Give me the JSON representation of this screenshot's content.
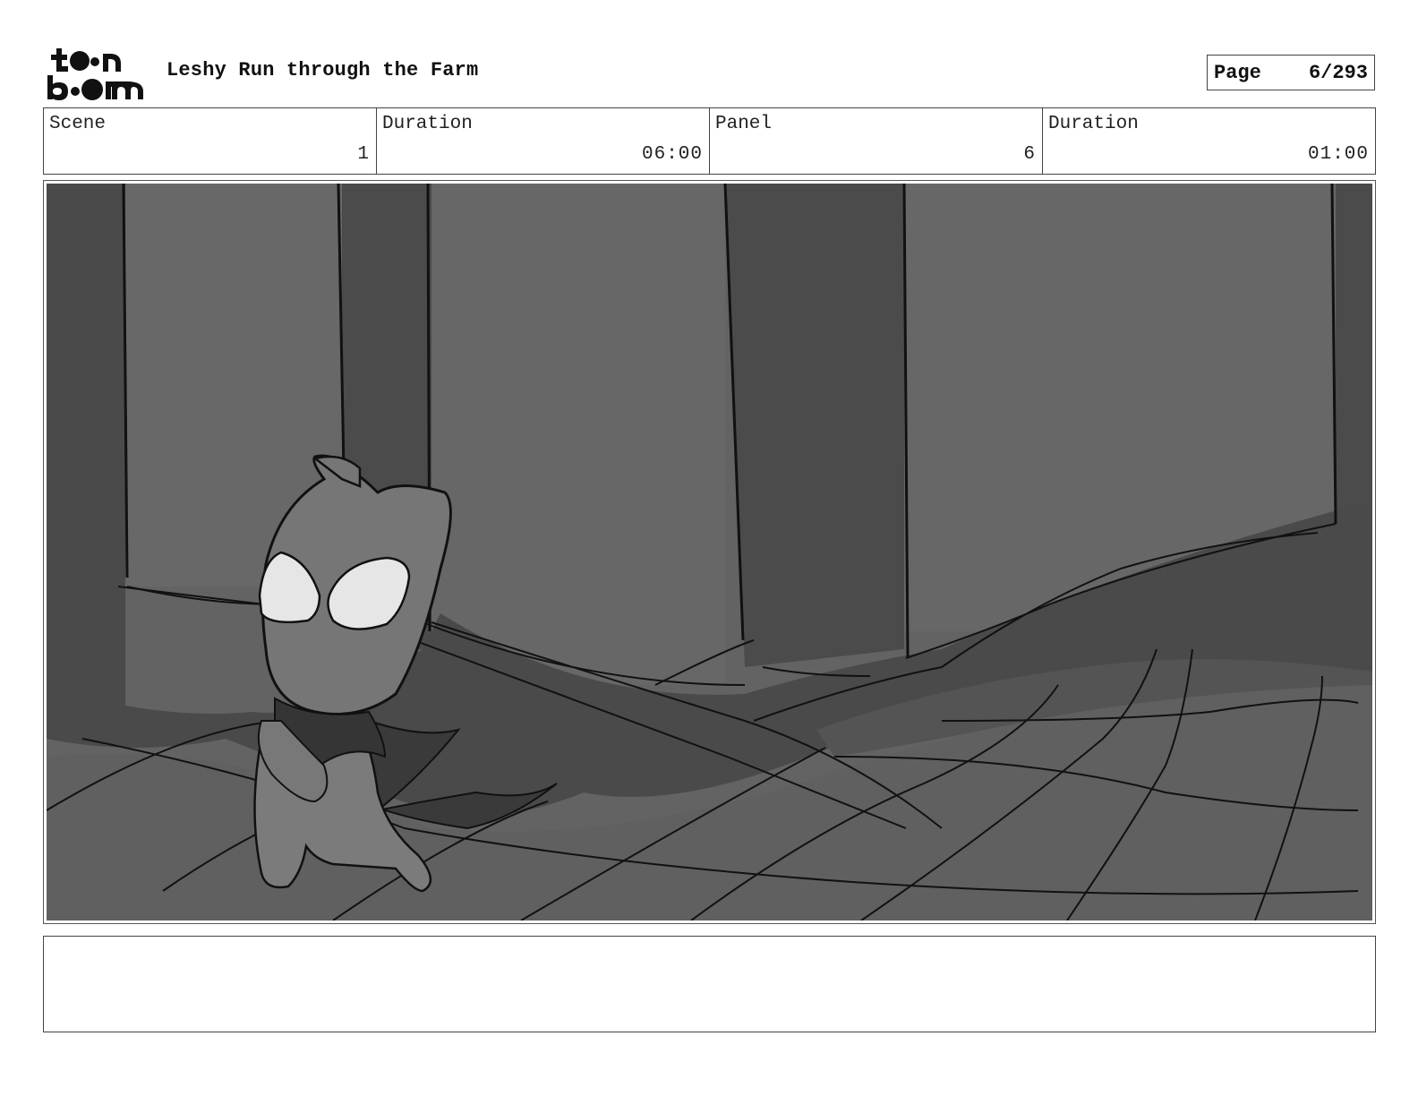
{
  "header": {
    "logo_text": "toon boom",
    "title": "Leshy Run through the Farm",
    "page_label": "Page",
    "page_value": "6/293"
  },
  "info": {
    "scene_label": "Scene",
    "scene_value": "1",
    "scene_duration_label": "Duration",
    "scene_duration_value": "06:00",
    "panel_label": "Panel",
    "panel_value": "6",
    "panel_duration_label": "Duration",
    "panel_duration_value": "01:00"
  },
  "panel": {
    "icon": "storyboard-drawing-image"
  },
  "notes": {
    "text": ""
  }
}
